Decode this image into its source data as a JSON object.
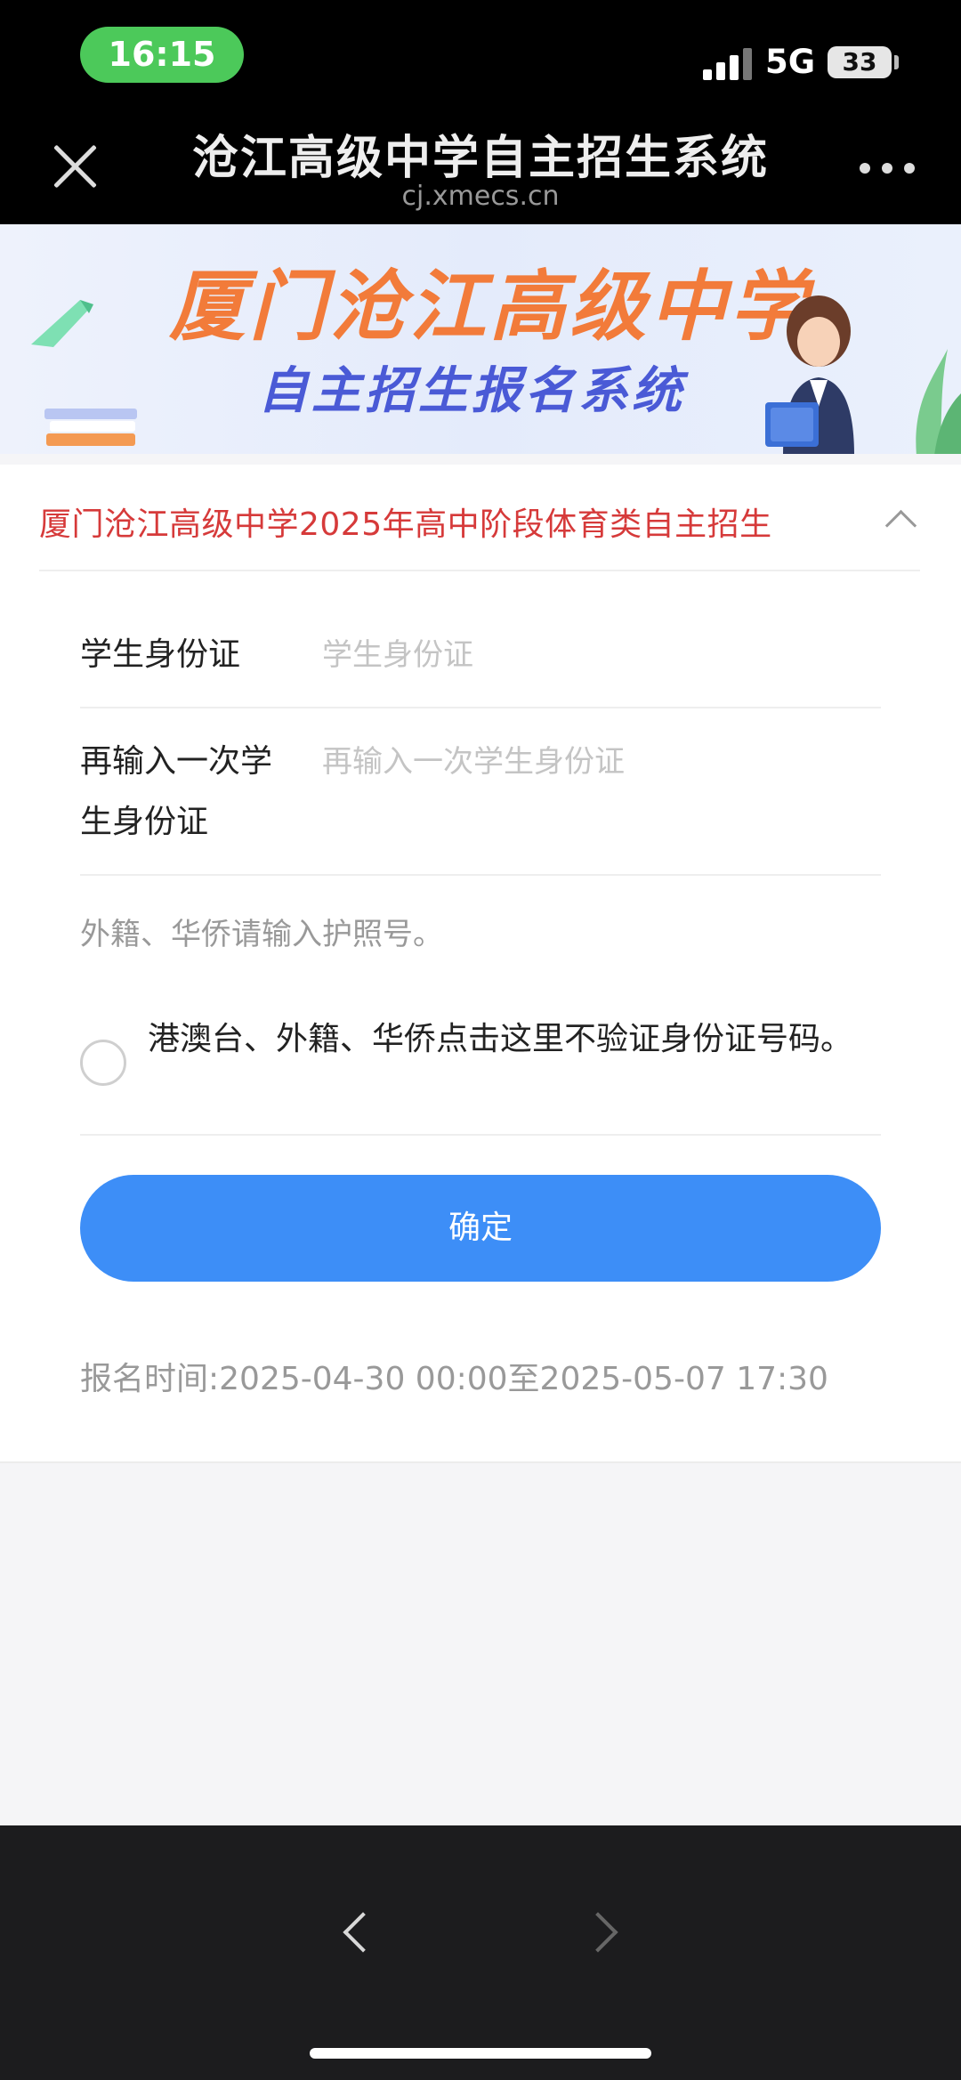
{
  "status_bar": {
    "time": "16:15",
    "network": "5G",
    "battery": "33",
    "time_pill_color": "#4cc95a"
  },
  "header": {
    "title": "沧江高级中学自主招生系统",
    "url": "cj.xmecs.cn",
    "close_icon": "close-icon",
    "more_icon": "more-icon"
  },
  "banner": {
    "title": "厦门沧江高级中学",
    "subtitle": "自主招生报名系统",
    "title_color": "#f27b3a",
    "subtitle_color": "#4a5ad6"
  },
  "section": {
    "title": "厦门沧江高级中学2025年高中阶段体育类自主招生",
    "title_color": "#d63a3a",
    "toggle_icon": "chevron-up-icon"
  },
  "form": {
    "id_label": "学生身份证",
    "id_placeholder": "学生身份证",
    "id_value": "",
    "confirm_id_label": "再输入一次学生身份证",
    "confirm_id_placeholder": "再输入一次学生身份证",
    "confirm_id_value": "",
    "hint": "外籍、华侨请输入护照号。",
    "skip_validation_label": "港澳台、外籍、华侨点击这里不验证身份证号码。",
    "skip_validation_checked": false,
    "confirm_button": "确定",
    "button_color": "#3d8ef7",
    "registration_time": "报名时间:2025-04-30 00:00至2025-05-07 17:30"
  },
  "bottom_bar": {
    "back_icon": "chevron-left-icon",
    "forward_icon": "chevron-right-icon"
  }
}
